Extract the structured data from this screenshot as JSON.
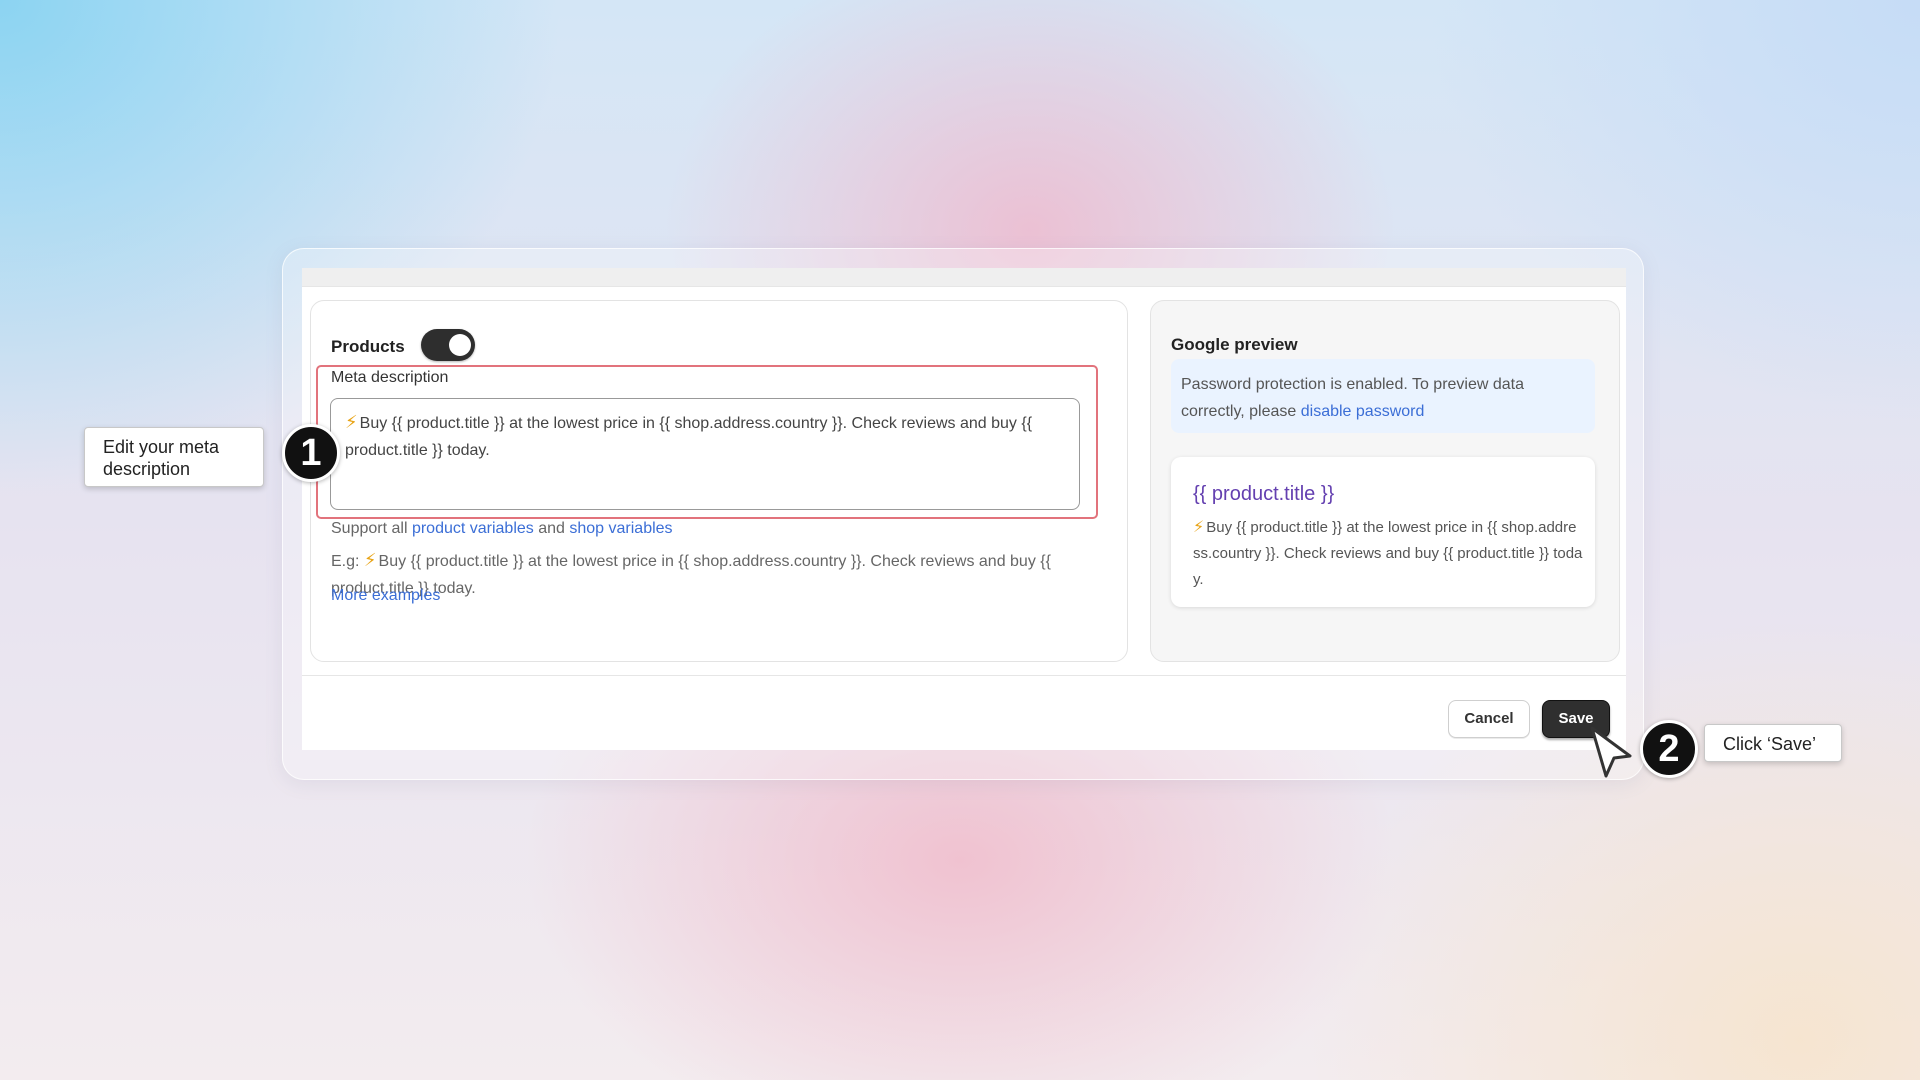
{
  "products": {
    "label": "Products",
    "toggle_on": true
  },
  "meta": {
    "label": "Meta description",
    "value": "Buy {{ product.title }} at the lowest price in {{ shop.address.country }}. Check reviews and buy {{ product.title }} today."
  },
  "support": {
    "prefix": "Support all ",
    "product_variables": "product variables",
    "and": " and ",
    "shop_variables": "shop variables"
  },
  "example": {
    "prefix": "E.g: ",
    "text": "Buy {{ product.title }} at the lowest price in {{ shop.address.country }}. Check reviews and buy {{ product.title }} today."
  },
  "more_examples": "More examples",
  "google_preview": {
    "title": "Google preview",
    "notice": "Password protection is enabled. To preview data correctly, please ",
    "notice_link": "disable password",
    "result_title": "{{ product.title }}",
    "result_desc": "Buy {{ product.title }} at the lowest price in {{ shop.address.country }}. Check reviews and buy {{ product.title }} today."
  },
  "buttons": {
    "cancel": "Cancel",
    "save": "Save"
  },
  "steps": {
    "step1_number": "1",
    "step1_tip": "Edit your meta description",
    "step2_number": "2",
    "step2_tip": "Click ‘Save’"
  },
  "colors": {
    "highlight": "#e2737c",
    "link": "#3b6ed6",
    "preview_title": "#6440b0",
    "primary_button": "#2f2f2f",
    "bolt": "#e8a417"
  },
  "icons": {
    "lightning": "lightning-icon",
    "cursor": "cursor-arrow-icon"
  }
}
